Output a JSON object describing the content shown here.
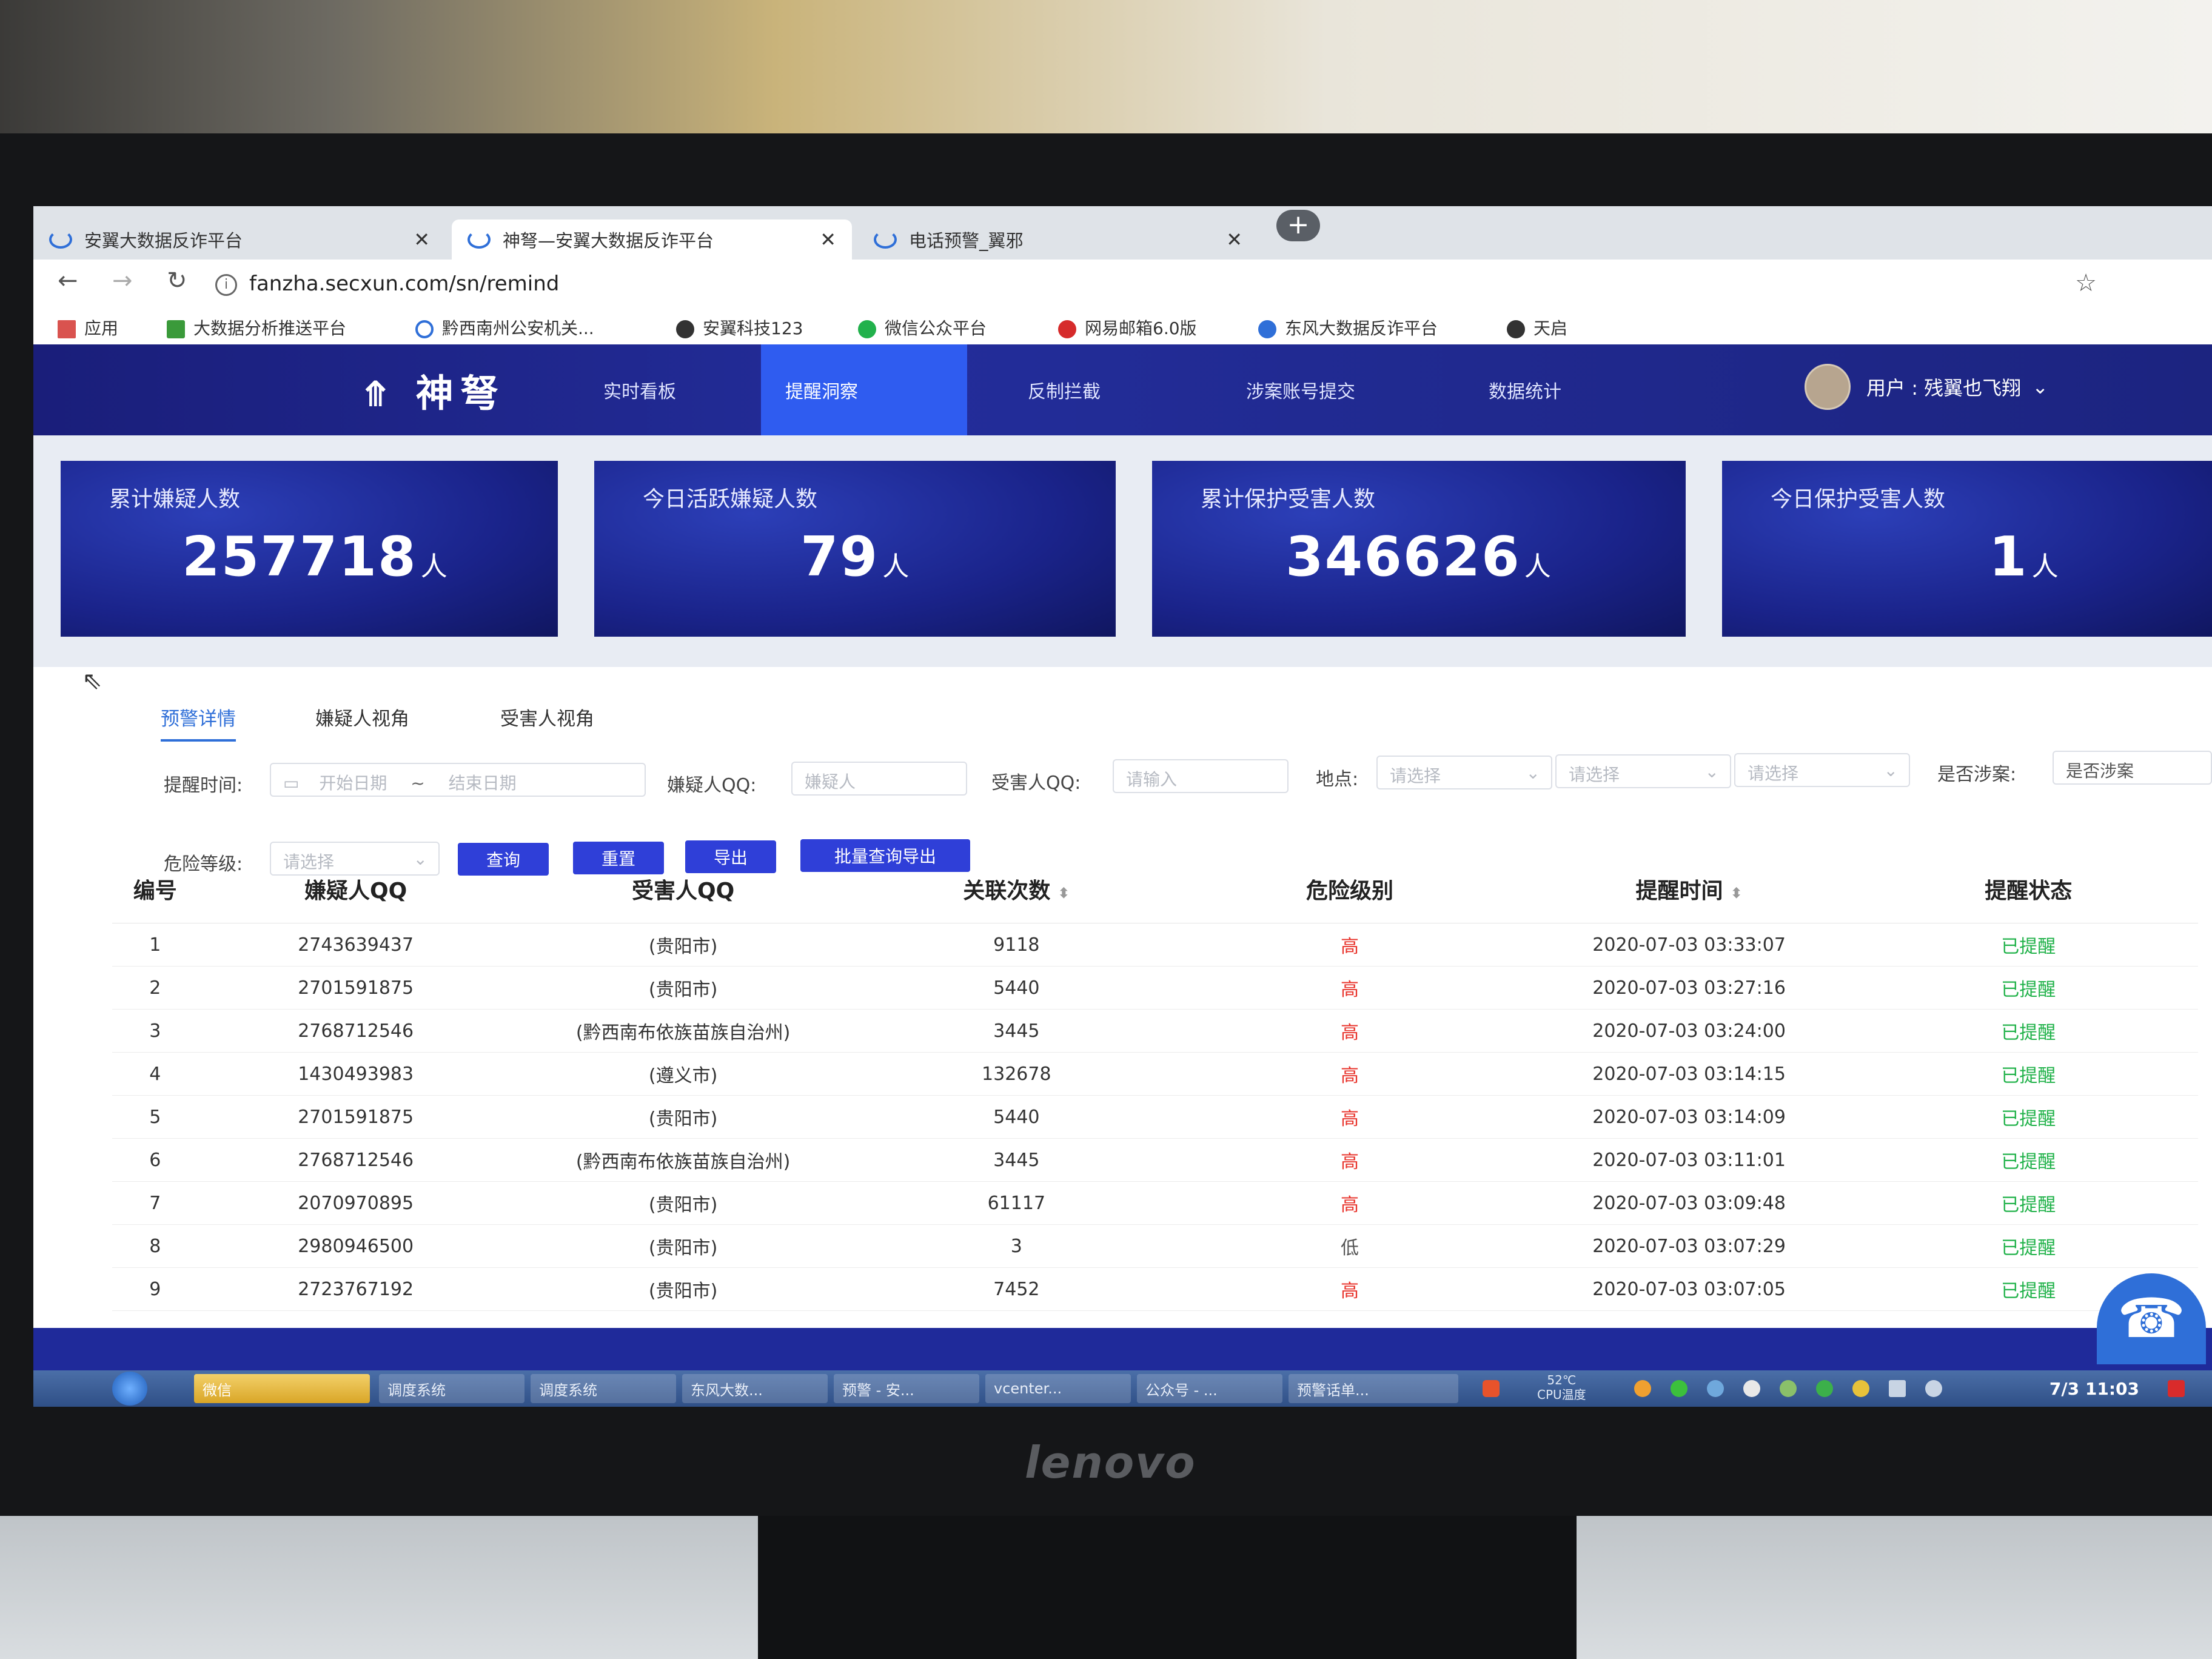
{
  "browser": {
    "tabs": [
      {
        "title": "安翼大数据反诈平台"
      },
      {
        "title": "神弩—安翼大数据反诈平台"
      },
      {
        "title": "电话预警_翼邪"
      }
    ],
    "url": "fanzha.secxun.com/sn/remind",
    "bookmarks": [
      {
        "label": "应用"
      },
      {
        "label": "大数据分析推送平台"
      },
      {
        "label": "黔西南州公安机关..."
      },
      {
        "label": "安翼科技123"
      },
      {
        "label": "微信公众平台"
      },
      {
        "label": "网易邮箱6.0版"
      },
      {
        "label": "东风大数据反诈平台"
      },
      {
        "label": "天启"
      }
    ]
  },
  "app": {
    "logo": "神弩",
    "menu": [
      {
        "label": "实时看板"
      },
      {
        "label": "提醒洞察"
      },
      {
        "label": "反制拦截"
      },
      {
        "label": "涉案账号提交"
      },
      {
        "label": "数据统计"
      }
    ],
    "user": "用户 : 残翼也飞翔"
  },
  "stats": [
    {
      "title": "累计嫌疑人数",
      "value": "257718",
      "unit": "人"
    },
    {
      "title": "今日活跃嫌疑人数",
      "value": "79",
      "unit": "人"
    },
    {
      "title": "累计保护受害人数",
      "value": "346626",
      "unit": "人"
    },
    {
      "title": "今日保护受害人数",
      "value": "1",
      "unit": "人"
    }
  ],
  "subtabs": [
    {
      "label": "预警详情"
    },
    {
      "label": "嫌疑人视角"
    },
    {
      "label": "受害人视角"
    }
  ],
  "filters": {
    "time_label": "提醒时间:",
    "start_ph": "开始日期",
    "sep": "~",
    "end_ph": "结束日期",
    "suspect_label": "嫌疑人QQ:",
    "suspect_ph": "嫌疑人",
    "victim_label": "受害人QQ:",
    "victim_ph": "请输入",
    "place_label": "地点:",
    "select_ph": "请选择",
    "case_label": "是否涉案:",
    "case_value": "是否涉案",
    "risk_label": "危险等级:"
  },
  "buttons": {
    "query": "查询",
    "reset": "重置",
    "export": "导出",
    "batch_export": "批量查询导出"
  },
  "table": {
    "headers": [
      "编号",
      "嫌疑人QQ",
      "受害人QQ",
      "关联次数",
      "危险级别",
      "提醒时间",
      "提醒状态"
    ],
    "rows": [
      [
        "1",
        "2743639437",
        "(贵阳市)",
        "9118",
        "高",
        "2020-07-03 03:33:07",
        "已提醒"
      ],
      [
        "2",
        "2701591875",
        "(贵阳市)",
        "5440",
        "高",
        "2020-07-03 03:27:16",
        "已提醒"
      ],
      [
        "3",
        "2768712546",
        "(黔西南布依族苗族自治州)",
        "3445",
        "高",
        "2020-07-03 03:24:00",
        "已提醒"
      ],
      [
        "4",
        "1430493983",
        "(遵义市)",
        "132678",
        "高",
        "2020-07-03 03:14:15",
        "已提醒"
      ],
      [
        "5",
        "2701591875",
        "(贵阳市)",
        "5440",
        "高",
        "2020-07-03 03:14:09",
        "已提醒"
      ],
      [
        "6",
        "2768712546",
        "(黔西南布依族苗族自治州)",
        "3445",
        "高",
        "2020-07-03 03:11:01",
        "已提醒"
      ],
      [
        "7",
        "2070970895",
        "(贵阳市)",
        "61117",
        "高",
        "2020-07-03 03:09:48",
        "已提醒"
      ],
      [
        "8",
        "2980946500",
        "(贵阳市)",
        "3",
        "低",
        "2020-07-03 03:07:29",
        "已提醒"
      ],
      [
        "9",
        "2723767192",
        "(贵阳市)",
        "7452",
        "高",
        "2020-07-03 03:07:05",
        "已提醒"
      ]
    ]
  },
  "taskbar": {
    "items": [
      "微信",
      "调度系统",
      "调度系统",
      "东风大数...",
      "预警 - 安...",
      "vcenter...",
      "公众号 - ...",
      "预警话单..."
    ],
    "temp": "52℃",
    "temp_label": "CPU温度",
    "clock": "7/3 11:03"
  },
  "monitor_brand": "lenovo"
}
